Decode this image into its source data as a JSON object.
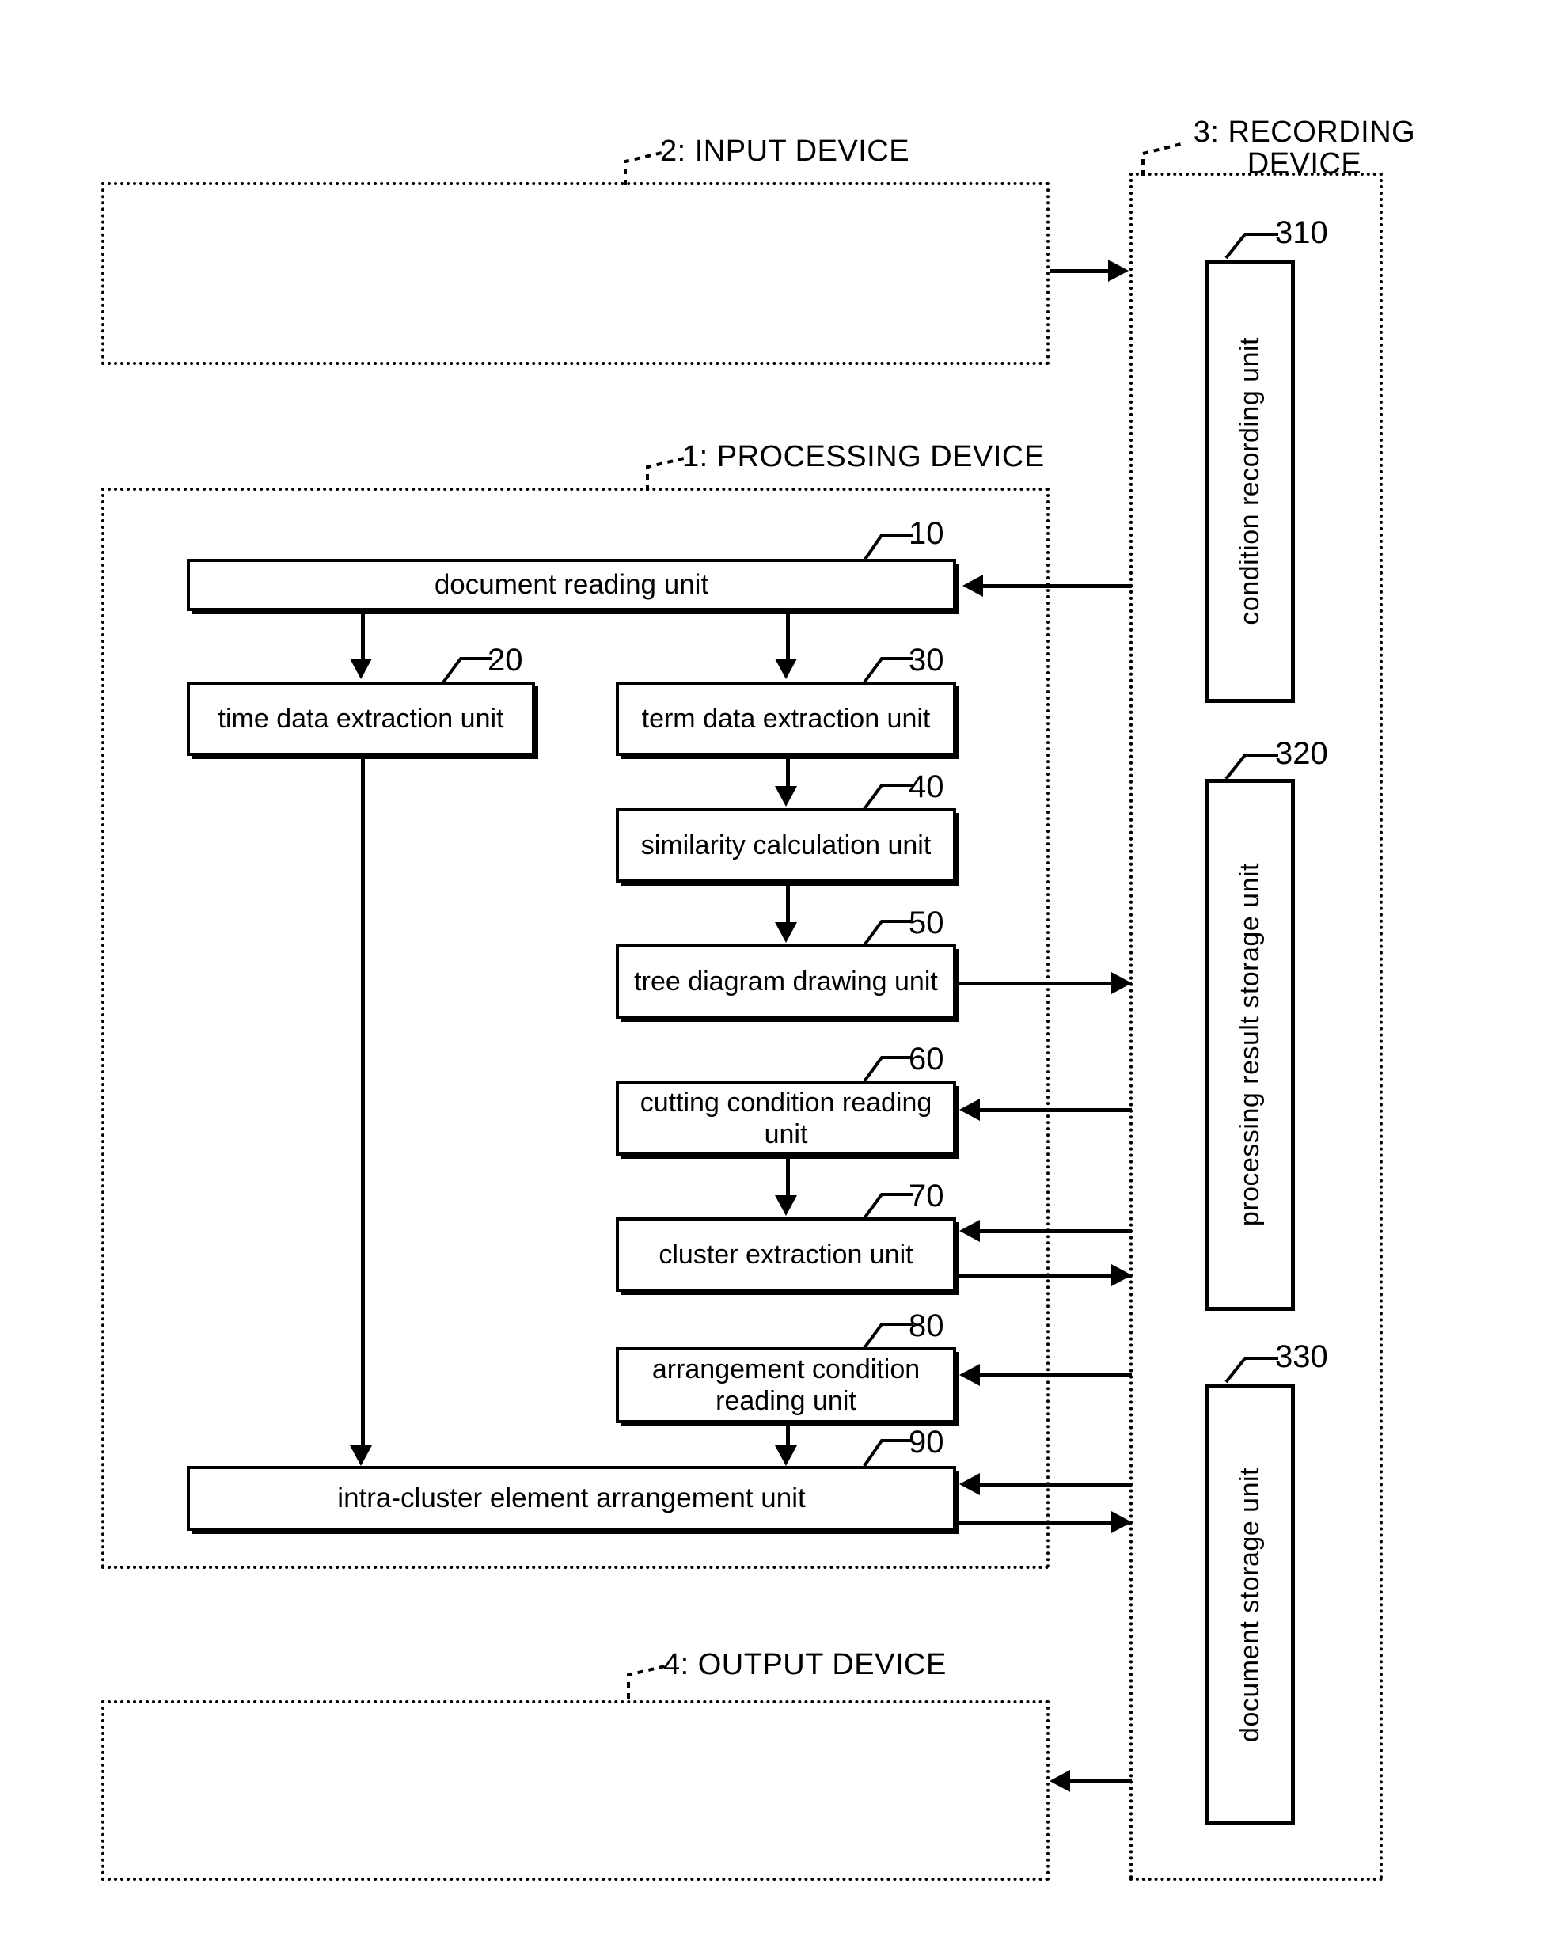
{
  "figure": {
    "type": "patent-block-diagram",
    "containers": [
      {
        "id": "input-device",
        "label": "2: INPUT DEVICE"
      },
      {
        "id": "recording-device",
        "label": "3: RECORDING DEVICE"
      },
      {
        "id": "processing-device",
        "label": "1: PROCESSING DEVICE"
      },
      {
        "id": "output-device",
        "label": "4: OUTPUT DEVICE"
      }
    ],
    "processing_units": [
      {
        "ref": "10",
        "label": "document reading unit"
      },
      {
        "ref": "20",
        "label": "time data extraction unit"
      },
      {
        "ref": "30",
        "label": "term data extraction unit"
      },
      {
        "ref": "40",
        "label": "similarity calculation unit"
      },
      {
        "ref": "50",
        "label": "tree diagram drawing unit"
      },
      {
        "ref": "60",
        "label": "cutting condition reading unit"
      },
      {
        "ref": "70",
        "label": "cluster extraction unit"
      },
      {
        "ref": "80",
        "label": "arrangement condition reading unit"
      },
      {
        "ref": "90",
        "label": "intra-cluster element arrangement unit"
      }
    ],
    "recording_units": [
      {
        "ref": "310",
        "label": "condition recording unit"
      },
      {
        "ref": "320",
        "label": "processing result storage unit"
      },
      {
        "ref": "330",
        "label": "document storage unit"
      }
    ],
    "colors": {
      "ink": "#000000",
      "paper": "#ffffff"
    }
  }
}
